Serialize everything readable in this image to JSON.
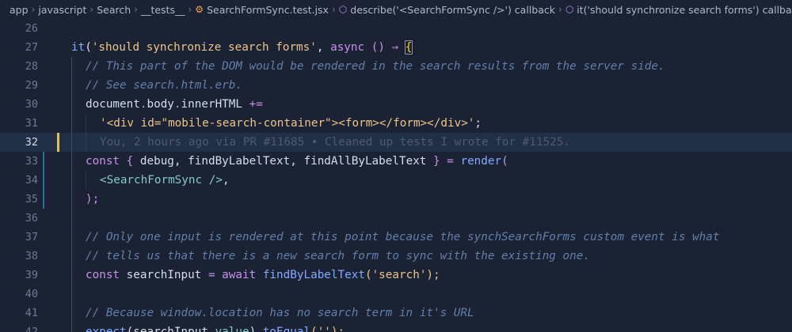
{
  "breadcrumb": {
    "items": [
      "app",
      "javascript",
      "Search",
      "__tests__",
      "SearchFormSync.test.jsx",
      "describe('<SearchFormSync />') callback",
      "it('should synchronize search forms') callback"
    ]
  },
  "editor": {
    "line_numbers": [
      "26",
      "27",
      "28",
      "29",
      "30",
      "31",
      "32",
      "33",
      "34",
      "35",
      "36",
      "37",
      "38",
      "39",
      "40",
      "41",
      "42"
    ],
    "lines": {
      "l27": {
        "it": "it",
        "open": "(",
        "title": "'should synchronize search forms'",
        "comma": ", ",
        "async": "async",
        "arrow": " () ⇒ ",
        "brace": "{"
      },
      "l28": {
        "comment": "// This part of the DOM would be rendered in the search results from the server side."
      },
      "l29": {
        "comment": "// See search.html.erb."
      },
      "l30": {
        "obj": "document",
        "dot1": ".",
        "body": "body",
        "dot2": ".",
        "inner": "innerHTML",
        "op": " +="
      },
      "l31": {
        "str": "'<div id=\"mobile-search-container\"><form></form></div>'",
        "semi": ";"
      },
      "l32": {
        "blame": "You, 2 hours ago via PR #11685 • Cleaned up tests I wrote for #11525."
      },
      "l33": {
        "const": "const",
        "lb": " { ",
        "a": "debug",
        "c1": ", ",
        "b": "findByLabelText",
        "c2": ", ",
        "c": "findAllByLabelText",
        "rb": " } ",
        "eq": "=",
        "sp": " ",
        "fn": "render",
        "paren": "("
      },
      "l34": {
        "jsx": "<SearchFormSync />",
        "comma": ","
      },
      "l35": {
        "close": ");"
      },
      "l37": {
        "comment": "// Only one input is rendered at this point because the synchSearchForms custom event is what"
      },
      "l38": {
        "comment": "// tells us that there is a new search form to sync with the existing one."
      },
      "l39": {
        "const": "const",
        "name": " searchInput ",
        "eq": "=",
        "await": " await ",
        "fn": "findByLabelText",
        "args": "('search');"
      },
      "l41": {
        "comment": "// Because window.location has no search term in it's URL"
      },
      "l42": {
        "fn": "expect",
        "open": "(",
        "arg": "searchInput",
        "dot": ".",
        "prop": "value",
        "close": ")",
        "dot2": ".",
        "fn2": "toEqual",
        "args": "('');"
      }
    }
  }
}
